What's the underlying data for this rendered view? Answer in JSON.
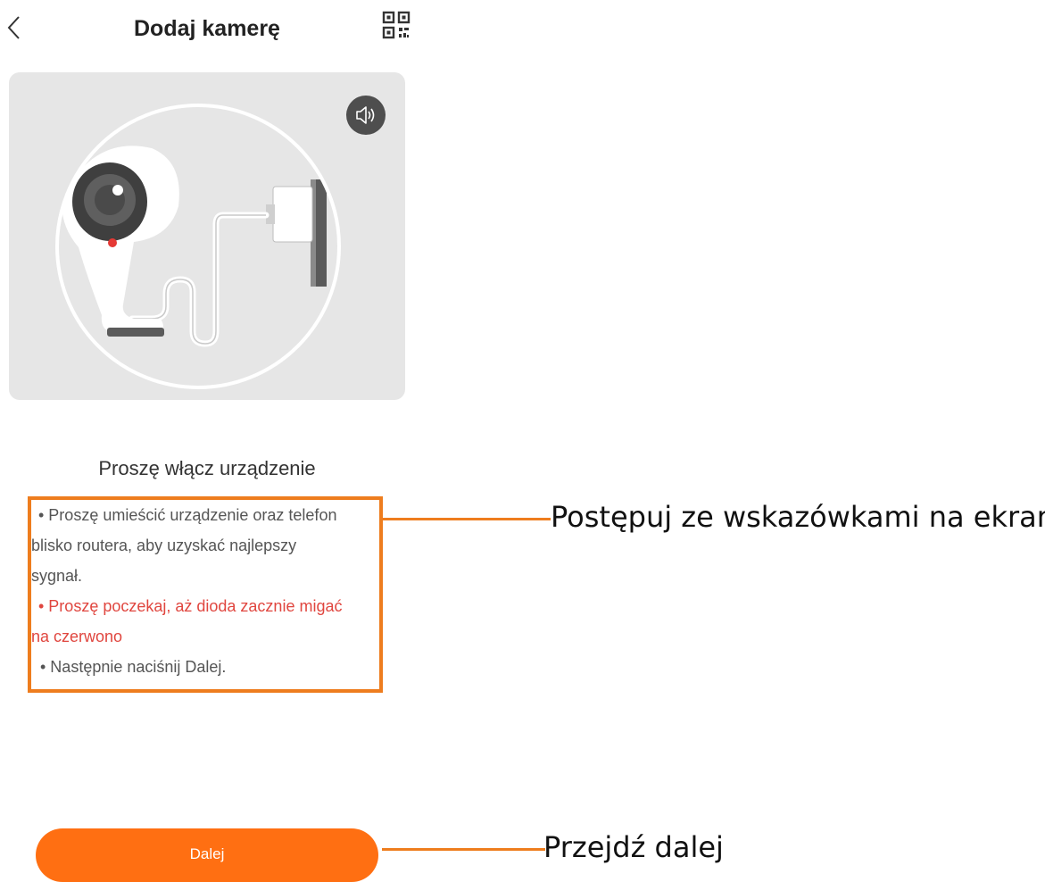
{
  "header": {
    "title": "Dodaj kamerę",
    "back_icon": "chevron-left-icon",
    "qr_icon": "qr-code-icon"
  },
  "illustration": {
    "sound_icon": "speaker-icon",
    "indicator_color": "#e53935"
  },
  "instructions": {
    "title": "Proszę włącz urządzenie",
    "lines": [
      "• Proszę umieścić urządzenie oraz telefon",
      "blisko routera, aby uzyskać najlepszy",
      "sygnał.",
      "• Proszę poczekaj, aż dioda zacznie migać",
      "na czerwono",
      "• Następnie naciśnij Dalej."
    ]
  },
  "annotations": {
    "tips": "Postępuj ze wskazówkami na ekranie",
    "next": "Przejdź dalej"
  },
  "footer": {
    "next_label": "Dalej"
  },
  "colors": {
    "accent": "#ff6f12",
    "highlight_border": "#ee7d1e",
    "warning_text": "#e0463f"
  }
}
